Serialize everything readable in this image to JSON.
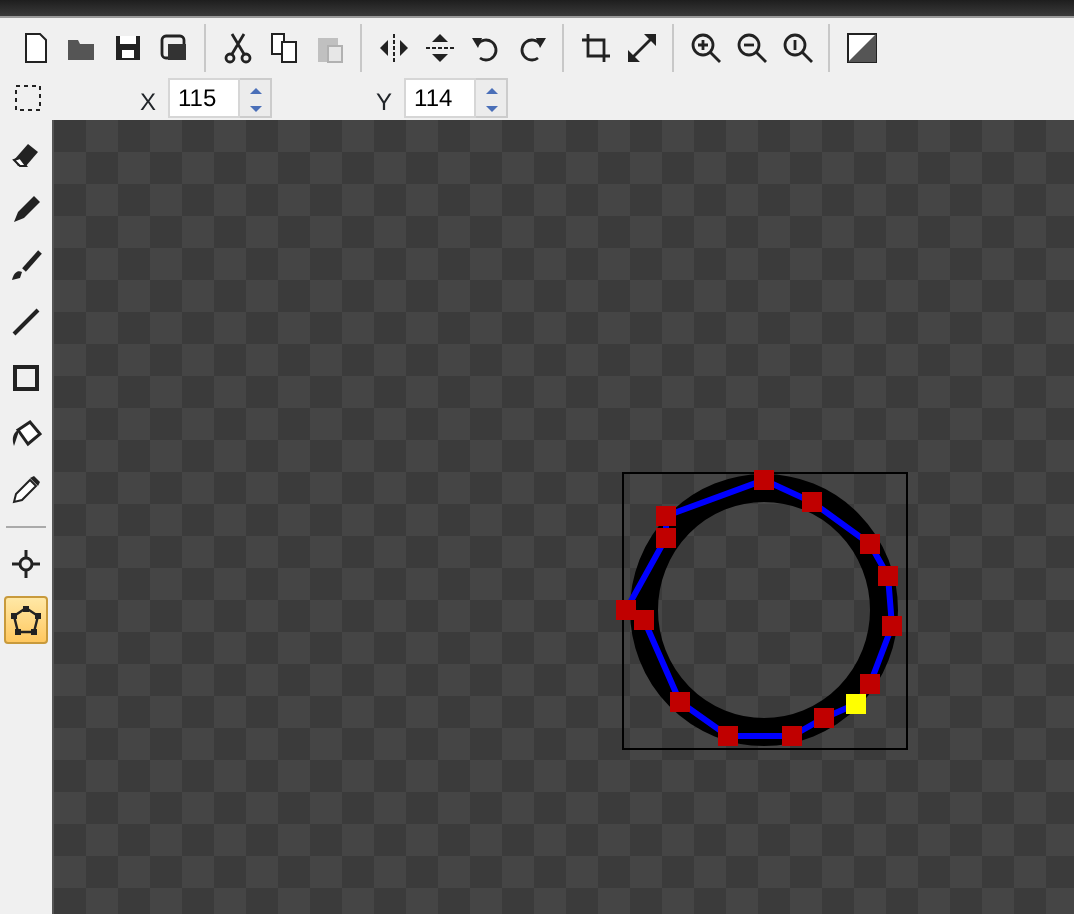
{
  "toolbar_groups": [
    [
      {
        "disabled": false
      },
      {
        "disabled": false
      },
      {
        "disabled": false
      },
      {
        "disabled": false
      }
    ],
    [
      {
        "disabled": false
      },
      {
        "disabled": false
      },
      {
        "disabled": true
      }
    ],
    [
      {
        "disabled": false
      },
      {
        "disabled": false
      },
      {
        "disabled": false
      },
      {
        "disabled": false
      }
    ],
    [
      {
        "disabled": false
      },
      {
        "disabled": false
      }
    ],
    [
      {
        "disabled": false
      },
      {
        "disabled": false
      },
      {
        "disabled": false
      }
    ],
    [
      {
        "disabled": false
      }
    ]
  ],
  "position": {
    "x_label": "X",
    "x_value": "115",
    "y_label": "Y",
    "y_value": "114"
  },
  "tools": [
    {
      "selected": false
    },
    {
      "selected": false
    },
    {
      "selected": false
    },
    {
      "selected": false
    },
    {
      "selected": false
    },
    {
      "selected": false
    },
    {
      "selected": false
    },
    {
      "selected": false
    },
    {
      "selected": true
    }
  ]
}
